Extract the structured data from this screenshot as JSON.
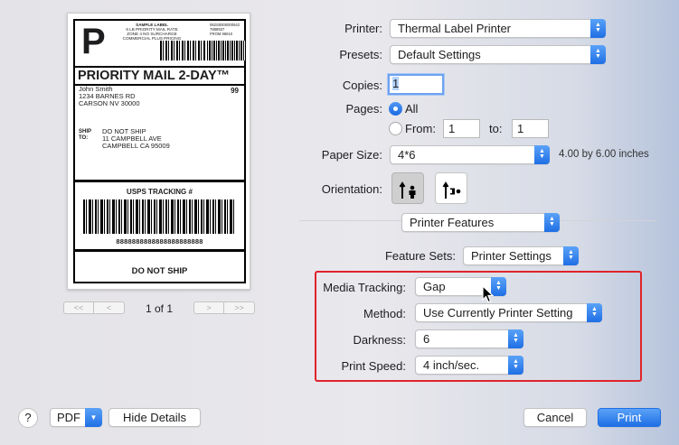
{
  "preview": {
    "label": {
      "service_letter": "P",
      "sample_lines": [
        "SAMPLE LABEL",
        "6 LB PRIORITY MAIL RATE",
        "ZONE 4 NO SURCHARGE",
        "COMMERCIAL PLUS PRICING"
      ],
      "tracking_refs": [
        "062S0000000542",
        "7888937",
        "FROM 96610"
      ],
      "service_title": "PRIORITY MAIL 2-DAY™",
      "from_lines": [
        "John Smith",
        "1234 BARNES RD",
        "CARSON NV 30000"
      ],
      "from_code": "99",
      "ship_to_label_1": "SHIP",
      "ship_to_label_2": "TO:",
      "to_lines": [
        "DO NOT SHIP",
        "11 CAMPBELL AVE",
        "CAMPBELL CA 95009"
      ],
      "tracking_title": "USPS TRACKING #",
      "tracking_number": "8888888888888888888888",
      "footer": "DO NOT SHIP"
    },
    "pager": {
      "first": "<<",
      "prev": "<",
      "page_text": "1 of 1",
      "next": ">",
      "last": ">>"
    }
  },
  "printer": {
    "label": "Printer:",
    "value": "Thermal Label Printer"
  },
  "presets": {
    "label": "Presets:",
    "value": "Default Settings"
  },
  "copies": {
    "label": "Copies:",
    "value": "1"
  },
  "pages": {
    "label": "Pages:",
    "all_label": "All",
    "from_label": "From:",
    "from_value": "1",
    "to_label": "to:",
    "to_value": "1",
    "selected": "All"
  },
  "paper_size": {
    "label": "Paper Size:",
    "value": "4*6",
    "dimensions": "4.00 by 6.00 inches"
  },
  "orientation": {
    "label": "Orientation:",
    "selected": "portrait"
  },
  "section": {
    "value": "Printer Features"
  },
  "feature_sets": {
    "label": "Feature Sets:",
    "value": "Printer Settings"
  },
  "media_tracking": {
    "label": "Media Tracking:",
    "value": "Gap"
  },
  "method": {
    "label": "Method:",
    "value": "Use Currently Printer Setting"
  },
  "darkness": {
    "label": "Darkness:",
    "value": "6"
  },
  "print_speed": {
    "label": "Print Speed:",
    "value": "4 inch/sec."
  },
  "footer": {
    "help": "?",
    "pdf": "PDF",
    "hide_details": "Hide Details",
    "cancel": "Cancel",
    "print": "Print"
  },
  "colors": {
    "accent": "#1f6fe5",
    "highlight_box": "#e0232b"
  },
  "icons": [
    "portrait-icon",
    "landscape-icon",
    "chevron-updown-icon",
    "chevron-down-icon",
    "help-icon",
    "mouse-pointer-icon"
  ]
}
